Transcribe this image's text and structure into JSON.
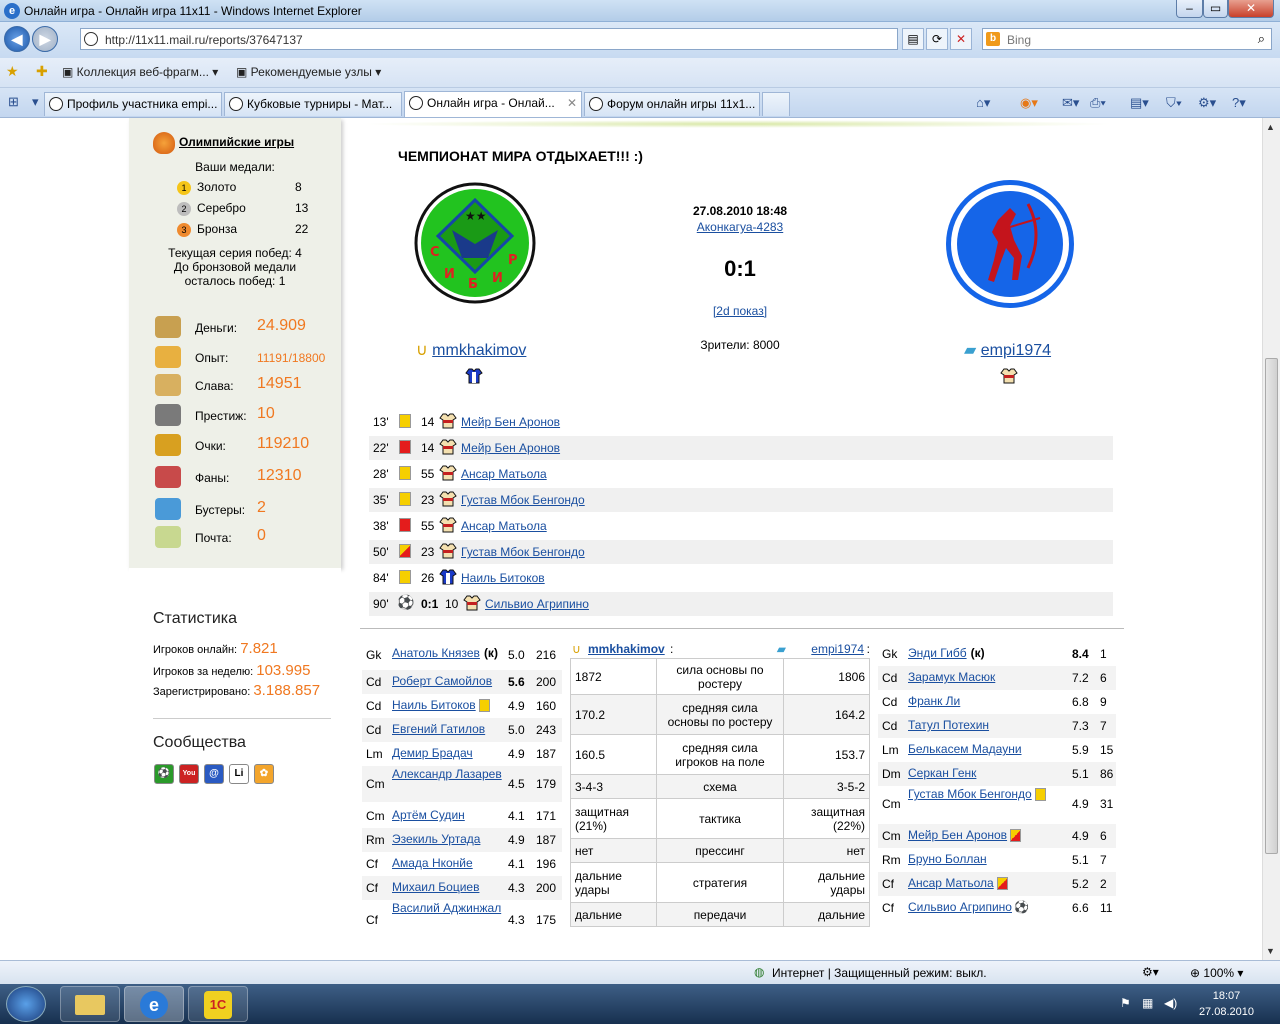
{
  "window": {
    "title": "Онлайн игра - Онлайн игра 11х11 - Windows Internet Explorer"
  },
  "browser": {
    "url": "http://11x11.mail.ru/reports/37647137",
    "search_placeholder": "Bing",
    "favorites": [
      "Коллекция веб-фрагм...",
      "Рекомендуемые узлы"
    ],
    "tabs": [
      "Профиль участника empi...",
      "Кубковые турниры - Мат...",
      "Онлайн игра - Онлай...",
      "Форум онлайн игры 11х1..."
    ]
  },
  "left": {
    "olympic_title": "Олимпийские игры",
    "medals_label": "Ваши медали:",
    "medals": [
      {
        "name": "Золото",
        "count": "8",
        "color": "#f5c518",
        "n": "1"
      },
      {
        "name": "Серебро",
        "count": "13",
        "color": "#bdbdbd",
        "n": "2"
      },
      {
        "name": "Бронза",
        "count": "22",
        "color": "#ef8a2e",
        "n": "3"
      }
    ],
    "streak": "Текущая серия побед: 4",
    "bronze_line1": "До бронзовой медали",
    "bronze_line2": "осталось побед: 1",
    "stats": [
      {
        "label": "Деньги:",
        "value": "24.909"
      },
      {
        "label": "Опыт:",
        "value": "11191/18800"
      },
      {
        "label": "Слава:",
        "value": "14951"
      },
      {
        "label": "Престиж:",
        "value": "10"
      },
      {
        "label": "Очки:",
        "value": "119210"
      },
      {
        "label": "Фаны:",
        "value": "12310"
      },
      {
        "label": "Бустеры:",
        "value": "2"
      },
      {
        "label": "Почта:",
        "value": "0"
      }
    ],
    "statistics_title": "Статистика",
    "online_label": "Игроков онлайн:",
    "online_value": "7.821",
    "week_label": "Игроков за неделю:",
    "week_value": "103.995",
    "reg_label": "Зарегистрировано:",
    "reg_value": "3.188.857",
    "communities_title": "Сообщества"
  },
  "match": {
    "headline": "ЧЕМПИОНАТ МИРА ОТДЫХАЕТ!!!   :)",
    "datetime": "27.08.2010 18:48",
    "stadium": "Аконкагуа-4283",
    "score": "0:1",
    "replay": "[2d показ]",
    "spectators": "Зрители: 8000",
    "home": {
      "name": "mmkhakimov",
      "logo_text": "СИБИРЬ"
    },
    "away": {
      "name": "empi1974"
    }
  },
  "events": [
    {
      "min": "13'",
      "card": "yellow",
      "num": "14",
      "player": "Мейр Бен Аронов",
      "kit": "away"
    },
    {
      "min": "22'",
      "card": "red",
      "num": "14",
      "player": "Мейр Бен Аронов",
      "kit": "away"
    },
    {
      "min": "28'",
      "card": "yellow",
      "num": "55",
      "player": "Ансар Матьола",
      "kit": "away"
    },
    {
      "min": "35'",
      "card": "yellow",
      "num": "23",
      "player": "Густав Мбок Бенгондо",
      "kit": "away"
    },
    {
      "min": "38'",
      "card": "red",
      "num": "55",
      "player": "Ансар Матьола",
      "kit": "away"
    },
    {
      "min": "50'",
      "card": "yr",
      "num": "23",
      "player": "Густав Мбок Бенгондо",
      "kit": "away"
    },
    {
      "min": "84'",
      "card": "yellow",
      "num": "26",
      "player": "Наиль Битоков",
      "kit": "home"
    },
    {
      "min": "90'",
      "card": "goal",
      "score": "0:1",
      "num": "10",
      "player": "Сильвио Агрипино",
      "kit": "away"
    }
  ],
  "home_lineup": [
    {
      "pos": "Gk",
      "name": "Анатоль Князев",
      "extra": "(к)",
      "rating": "5.0",
      "age": "216"
    },
    {
      "pos": "Cd",
      "name": "Роберт Самойлов",
      "rating": "5.6",
      "age": "200",
      "bold": true
    },
    {
      "pos": "Cd",
      "name": "Наиль Битоков",
      "rating": "4.9",
      "age": "160",
      "card": "yellow"
    },
    {
      "pos": "Cd",
      "name": "Евгений Гатилов",
      "rating": "5.0",
      "age": "243"
    },
    {
      "pos": "Lm",
      "name": "Демир Брадач",
      "rating": "4.9",
      "age": "187"
    },
    {
      "pos": "Cm",
      "name": "Александр Лазарев",
      "rating": "4.5",
      "age": "179"
    },
    {
      "pos": "Cm",
      "name": "Артём Судин",
      "rating": "4.1",
      "age": "171"
    },
    {
      "pos": "Rm",
      "name": "Эзекиль Уртада",
      "rating": "4.9",
      "age": "187"
    },
    {
      "pos": "Cf",
      "name": "Амада Нконйе",
      "rating": "4.1",
      "age": "196"
    },
    {
      "pos": "Cf",
      "name": "Михаил Боциев",
      "rating": "4.3",
      "age": "200"
    },
    {
      "pos": "Cf",
      "name": "Василий Аджинжал",
      "rating": "4.3",
      "age": "175"
    }
  ],
  "away_lineup": [
    {
      "pos": "Gk",
      "name": "Энди Гибб",
      "extra": "(к)",
      "rating": "8.4",
      "age": "1",
      "bold": true
    },
    {
      "pos": "Cd",
      "name": "Зарамук Масюк",
      "rating": "7.2",
      "age": "6"
    },
    {
      "pos": "Cd",
      "name": "Франк Ли",
      "rating": "6.8",
      "age": "9"
    },
    {
      "pos": "Cd",
      "name": "Татул Потехин",
      "rating": "7.3",
      "age": "7"
    },
    {
      "pos": "Lm",
      "name": "Белькасем Мадауни",
      "rating": "5.9",
      "age": "15"
    },
    {
      "pos": "Dm",
      "name": "Серкан Генк",
      "rating": "5.1",
      "age": "86"
    },
    {
      "pos": "Cm",
      "name": "Густав Мбок Бенгондо",
      "rating": "4.9",
      "age": "31",
      "card": "yellow"
    },
    {
      "pos": "Cm",
      "name": "Мейр Бен Аронов",
      "rating": "4.9",
      "age": "6",
      "card": "red"
    },
    {
      "pos": "Rm",
      "name": "Бруно Боллан",
      "rating": "5.1",
      "age": "7"
    },
    {
      "pos": "Cf",
      "name": "Ансар Матьола",
      "rating": "5.2",
      "age": "2",
      "card": "red"
    },
    {
      "pos": "Cf",
      "name": "Сильвио Агрипино",
      "rating": "6.6",
      "age": "11",
      "card": "goal"
    }
  ],
  "compare": [
    {
      "home": "1872",
      "label": "сила основы по ростеру",
      "away": "1806"
    },
    {
      "home": "170.2",
      "label": "средняя сила основы по ростеру",
      "away": "164.2"
    },
    {
      "home": "160.5",
      "label": "средняя сила игроков на поле",
      "away": "153.7"
    },
    {
      "home": "3-4-3",
      "label": "схема",
      "away": "3-5-2"
    },
    {
      "home": "защитная (21%)",
      "label": "тактика",
      "away": "защитная (22%)"
    },
    {
      "home": "нет",
      "label": "прессинг",
      "away": "нет"
    },
    {
      "home": "дальние удары",
      "label": "стратегия",
      "away": "дальние удары"
    },
    {
      "home": "дальние",
      "label": "передачи",
      "away": "дальние"
    }
  ],
  "status": {
    "zone": "Интернет | Защищенный режим: выкл.",
    "zoom": "100%"
  },
  "taskbar": {
    "time": "18:07",
    "date": "27.08.2010"
  },
  "colors": {
    "accent": "#f07820",
    "link": "#1a4fa0",
    "home_logo": "#22c31f",
    "away_logo": "#1565e8"
  }
}
